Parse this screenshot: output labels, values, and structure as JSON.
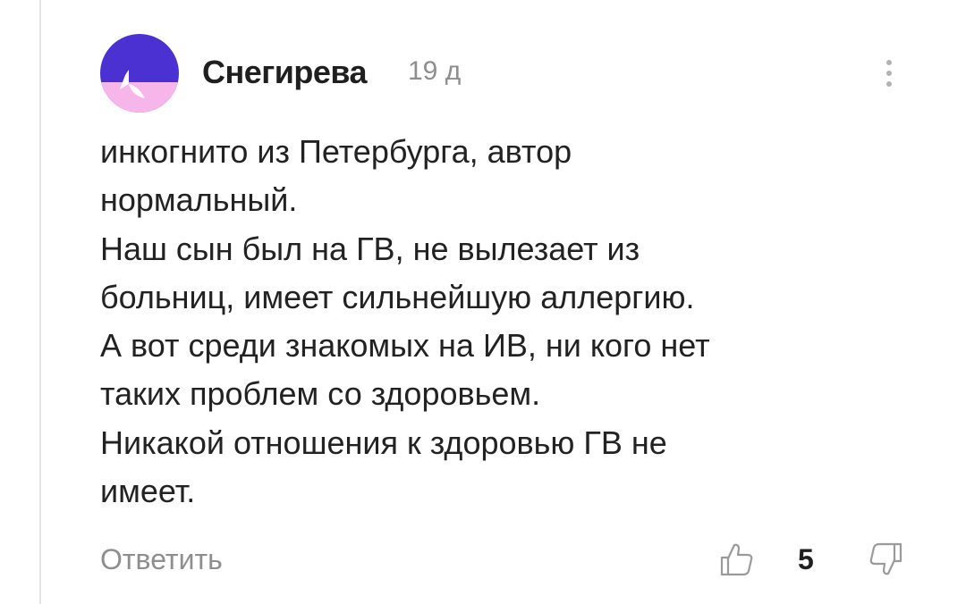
{
  "comment": {
    "author": "Снегирева",
    "timestamp": "19 д",
    "avatar_colors": {
      "top": "#4b31d1",
      "bottom": "#f7b6ea",
      "mark": "#ffffff"
    },
    "body_lines": [
      "инкогнито из Петербурга, автор",
      "нормальный.",
      "Наш сын был на ГВ, не вылезает из",
      "больниц, имеет сильнейшую аллергию.",
      "А вот среди знакомых на ИВ, ни кого нет",
      "таких проблем со здоровьем.",
      "Никакой отношения к здоровью ГВ не",
      "имеет."
    ],
    "actions": {
      "reply_label": "Ответить",
      "like_icon": "thumbs-up-icon",
      "like_count": "5",
      "dislike_icon": "thumbs-down-icon",
      "more_icon": "more-vertical-icon"
    }
  }
}
